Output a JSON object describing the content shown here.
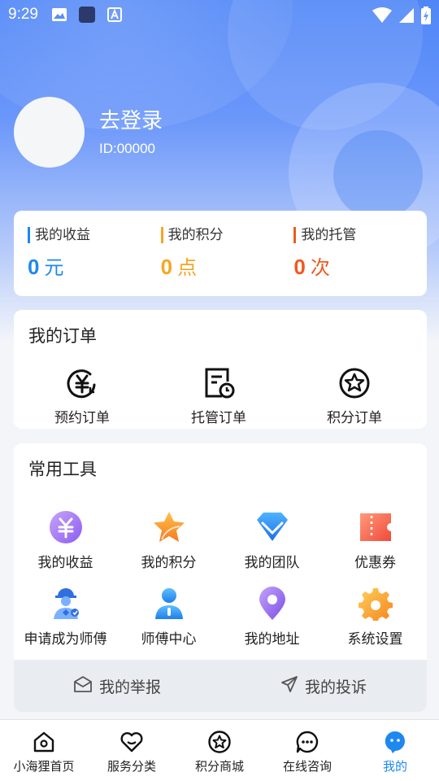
{
  "status_bar": {
    "time": "9:29"
  },
  "profile": {
    "login_text": "去登录",
    "id_text": "ID:00000"
  },
  "stats": [
    {
      "label": "我的收益",
      "value": "0",
      "unit": "元",
      "color": "#1e88f0"
    },
    {
      "label": "我的积分",
      "value": "0",
      "unit": "点",
      "color": "#f5a623"
    },
    {
      "label": "我的托管",
      "value": "0",
      "unit": "次",
      "color": "#ef5a1e"
    }
  ],
  "orders": {
    "title": "我的订单",
    "items": [
      {
        "label": "预约订单",
        "icon": "yen-clock-icon"
      },
      {
        "label": "托管订单",
        "icon": "document-clock-icon"
      },
      {
        "label": "积分订单",
        "icon": "star-circle-icon"
      }
    ]
  },
  "tools": {
    "title": "常用工具",
    "items": [
      {
        "label": "我的收益",
        "icon": "yen-coin-icon"
      },
      {
        "label": "我的积分",
        "icon": "star-icon"
      },
      {
        "label": "我的团队",
        "icon": "diamond-icon"
      },
      {
        "label": "优惠券",
        "icon": "coupon-icon"
      },
      {
        "label": "申请成为师傅",
        "icon": "worker-icon"
      },
      {
        "label": "师傅中心",
        "icon": "user-icon"
      },
      {
        "label": "我的地址",
        "icon": "location-pin-icon"
      },
      {
        "label": "系统设置",
        "icon": "gear-icon"
      }
    ],
    "report_label": "我的举报",
    "complaint_label": "我的投诉"
  },
  "tabbar": [
    {
      "label": "小海狸首页",
      "icon": "home-icon",
      "active": false
    },
    {
      "label": "服务分类",
      "icon": "heart-icon",
      "active": false
    },
    {
      "label": "积分商城",
      "icon": "star-circle-icon",
      "active": false
    },
    {
      "label": "在线咨询",
      "icon": "chat-icon",
      "active": false
    },
    {
      "label": "我的",
      "icon": "profile-icon",
      "active": true
    }
  ],
  "colors": {
    "accent": "#1e88f0",
    "header": "#4f86f7"
  }
}
